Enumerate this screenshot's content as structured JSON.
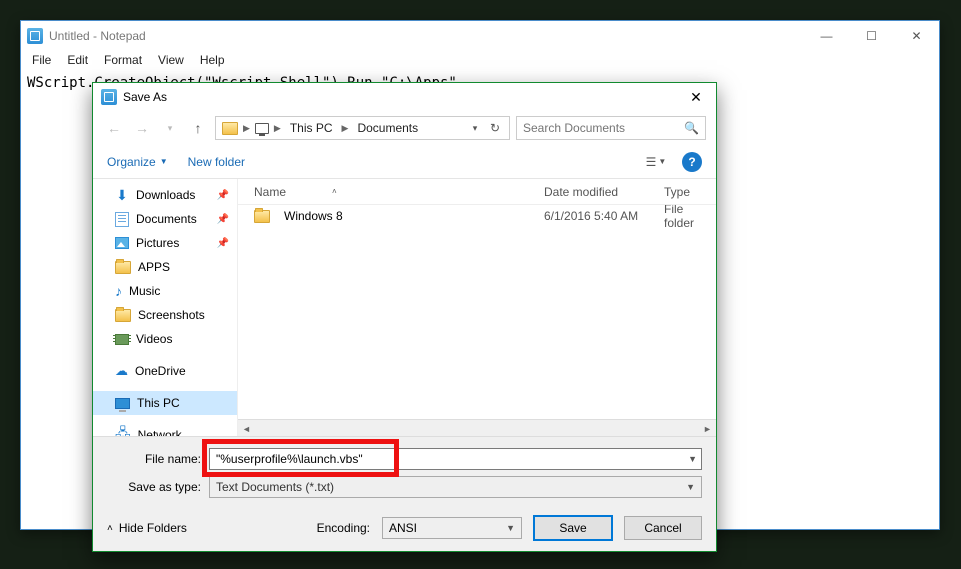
{
  "notepad": {
    "title": "Untitled - Notepad",
    "menu": [
      "File",
      "Edit",
      "Format",
      "View",
      "Help"
    ],
    "content": "WScript.CreateObject(\"Wscript.Shell\").Run \"C:\\Apps\""
  },
  "saveas": {
    "title": "Save As",
    "breadcrumb": [
      "This PC",
      "Documents"
    ],
    "search_placeholder": "Search Documents",
    "toolbar": {
      "organize": "Organize",
      "newfolder": "New folder"
    },
    "tree": [
      {
        "icon": "downloads",
        "label": "Downloads",
        "pin": true
      },
      {
        "icon": "docs",
        "label": "Documents",
        "pin": true
      },
      {
        "icon": "pics",
        "label": "Pictures",
        "pin": true
      },
      {
        "icon": "folder",
        "label": "APPS"
      },
      {
        "icon": "music",
        "label": "Music"
      },
      {
        "icon": "folder",
        "label": "Screenshots"
      },
      {
        "icon": "video",
        "label": "Videos"
      },
      {
        "gap": true
      },
      {
        "icon": "onedrive",
        "label": "OneDrive"
      },
      {
        "gap": true
      },
      {
        "icon": "pc",
        "label": "This PC",
        "selected": true
      },
      {
        "gap": true
      },
      {
        "icon": "network",
        "label": "Network"
      }
    ],
    "columns": {
      "name": "Name",
      "date": "Date modified",
      "type": "Type"
    },
    "rows": [
      {
        "name": "Windows 8",
        "date": "6/1/2016 5:40 AM",
        "type": "File folder"
      }
    ],
    "filename_label": "File name:",
    "filename_value": "\"%userprofile%\\launch.vbs\"",
    "filetype_label": "Save as type:",
    "filetype_value": "Text Documents (*.txt)",
    "hide_folders": "Hide Folders",
    "encoding_label": "Encoding:",
    "encoding_value": "ANSI",
    "save": "Save",
    "cancel": "Cancel"
  }
}
